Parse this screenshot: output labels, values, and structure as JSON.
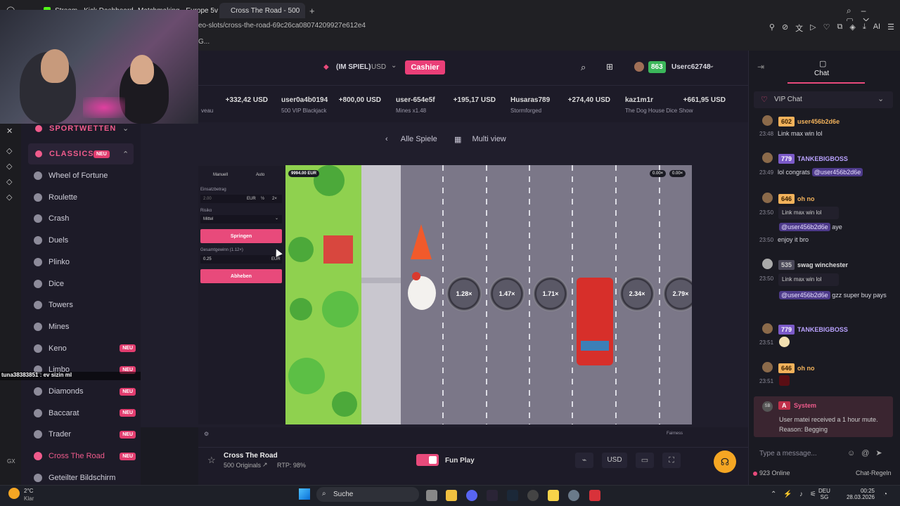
{
  "browser": {
    "tabs": [
      {
        "label": "Stream - Kick Dashboard",
        "color": "#53fc18"
      },
      {
        "label": "Matchmaking - Europe 5v",
        "color": "#f07020"
      },
      {
        "label": "Cross The Road - 500",
        "color": "#e23d6f"
      }
    ],
    "address": "eo-slots/cross-the-road-69c26ca08074209927e612e4",
    "address_line2": "G..."
  },
  "header": {
    "balance_label": "(IM SPIEL)",
    "currency": "USD",
    "cashier": "Cashier",
    "level": "863",
    "username": "Userc62748"
  },
  "ticker": [
    {
      "amount": "+332,42 USD",
      "sub": "veau"
    },
    {
      "name": "user0a4b0194",
      "amount": "+800,00 USD",
      "sub": "500 VIP Blackjack"
    },
    {
      "name": "user-654e5f",
      "amount": "+195,17 USD",
      "sub": "Mines x1.48"
    },
    {
      "name": "Husaras789",
      "amount": "+274,40 USD",
      "sub": "Stormforged"
    },
    {
      "name": "kaz1m1r",
      "amount": "+661,95 USD",
      "sub": "The Dog House Dice Show"
    }
  ],
  "sidebar": {
    "sportwetten": "SPORTWETTEN",
    "classics": "CLASSICS",
    "classics_badge": "NEU",
    "items": [
      {
        "label": "Wheel of Fortune",
        "neu": ""
      },
      {
        "label": "Roulette",
        "neu": ""
      },
      {
        "label": "Crash",
        "neu": ""
      },
      {
        "label": "Duels",
        "neu": ""
      },
      {
        "label": "Plinko",
        "neu": ""
      },
      {
        "label": "Dice",
        "neu": ""
      },
      {
        "label": "Towers",
        "neu": ""
      },
      {
        "label": "Mines",
        "neu": ""
      },
      {
        "label": "Keno",
        "neu": "NEU"
      },
      {
        "label": "Limbo",
        "neu": "NEU"
      },
      {
        "label": "Diamonds",
        "neu": "NEU"
      },
      {
        "label": "Baccarat",
        "neu": "NEU"
      },
      {
        "label": "Trader",
        "neu": "NEU"
      },
      {
        "label": "Cross The Road",
        "neu": "NEU"
      },
      {
        "label": "Geteilter Bildschirm",
        "neu": ""
      }
    ]
  },
  "overlay_chat": "tuna38383851 : ev sizin ml",
  "game_nav": {
    "back": "Alle Spiele",
    "multi": "Multi view"
  },
  "panel": {
    "tab_manual": "Manuell",
    "tab_auto": "Auto",
    "bet_label": "Einsatzbetrag",
    "bet_value": "2.00",
    "bet_currency": "EUR",
    "half": "½",
    "double": "2×",
    "risk_label": "Risiko",
    "risk_value": "Mittel",
    "jump": "Springen",
    "total_label": "Gesamtgewinn (1.12×)",
    "total_value": "0.25",
    "total_currency": "EUR",
    "cashout": "Abheben"
  },
  "board": {
    "balance_pill": "9994.00 EUR",
    "pill_a": "0.00×",
    "pill_b": "0.00×",
    "multipliers": [
      "1.28×",
      "1.47×",
      "1.71×",
      "2.34×",
      "2.79×"
    ]
  },
  "under_board": {
    "fairness": "Fairness"
  },
  "bottom": {
    "game_title": "Cross The Road",
    "provider": "500 Originals",
    "rtp": "RTP: 98%",
    "fun_play": "Fun Play",
    "currency": "USD"
  },
  "chat": {
    "title": "Chat",
    "vip": "VIP Chat",
    "messages": [
      {
        "level": "602",
        "user": "user456b2d6e",
        "time": "23:48",
        "text": "Link  max win lol"
      },
      {
        "level": "779",
        "user": "TANKEBIGBOSS",
        "time": "23:49",
        "text": "lol congrats",
        "mention": "@user456b2d6e"
      },
      {
        "level": "646",
        "user": "oh no",
        "time": "23:50",
        "quote": "Link  max win lol",
        "mention": "@user456b2d6e",
        "text": "aye",
        "time2": "23:50",
        "text2": "enjoy it bro"
      },
      {
        "level": "535",
        "user": "swag winchester",
        "time": "23:50",
        "quote": "Link  max win lol",
        "mention": "@user456b2d6e",
        "text": "gzz super buy pays"
      },
      {
        "level": "779",
        "user": "TANKEBIGBOSS",
        "time": "23:51"
      },
      {
        "level": "646",
        "user": "oh no",
        "time": "23:51"
      }
    ],
    "system_badge": "A",
    "system_user": "System",
    "system_text": "User matei received a 1 hour mute. Reason: Begging",
    "placeholder": "Type a message...",
    "online": "923 Online",
    "rules": "Chat-Regeln"
  },
  "taskbar": {
    "temp": "2°C",
    "weather": "Klar",
    "search": "Suche",
    "lang1": "DEU",
    "lang2": "SG",
    "time": "00:25",
    "date": "28.03.2026",
    "gx": "GX"
  }
}
